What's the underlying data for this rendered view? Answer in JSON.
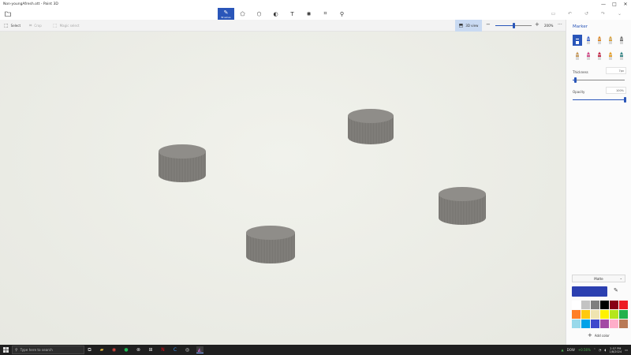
{
  "window": {
    "title": "Non-youngAfresh.ott - Paint 3D",
    "controls": [
      "—",
      "□",
      "✕"
    ]
  },
  "toolbar": {
    "menu_icon": "folder-icon",
    "tools": [
      {
        "name": "brushes",
        "label": "Brushes",
        "icon": "✎",
        "active": true
      },
      {
        "name": "2d-shapes",
        "label": "",
        "icon": "⬠",
        "active": false
      },
      {
        "name": "3d-shapes",
        "label": "",
        "icon": "⬡",
        "active": false
      },
      {
        "name": "stickers",
        "label": "",
        "icon": "◐",
        "active": false
      },
      {
        "name": "text",
        "label": "",
        "icon": "T",
        "active": false
      },
      {
        "name": "effects",
        "label": "",
        "icon": "✺",
        "active": false
      },
      {
        "name": "canvas",
        "label": "",
        "icon": "⌗",
        "active": false
      },
      {
        "name": "3d-library",
        "label": "",
        "icon": "⚲",
        "active": false
      }
    ],
    "right_tools": [
      "▭",
      "↶",
      "↺",
      "↷",
      "⌄"
    ]
  },
  "subbar": {
    "select": "Select",
    "crop": "Crop",
    "magic_select": "Magic select",
    "view_3d": "3D view",
    "zoom_value": "200%",
    "zoom_level": 0.5,
    "more": "···"
  },
  "panel": {
    "title": "Marker",
    "thickness_label": "Thickness",
    "thickness_value": "7px",
    "thickness_level": 0.05,
    "opacity_label": "Opacity",
    "opacity_value": "100%",
    "opacity_level": 1.0,
    "finish": "Matte",
    "current_color": "#2b3fb0",
    "add_color": "Add color",
    "brushes": [
      {
        "name": "marker",
        "color": "#2a56b9",
        "selected": true
      },
      {
        "name": "calligraphy-pen",
        "color": "#4b6fd1",
        "selected": false
      },
      {
        "name": "oil-brush",
        "color": "#e08a2a",
        "selected": false
      },
      {
        "name": "watercolor",
        "color": "#d9a441",
        "selected": false
      },
      {
        "name": "pixel-pen",
        "color": "#777777",
        "selected": false
      },
      {
        "name": "pencil",
        "color": "#c99a5a",
        "selected": false
      },
      {
        "name": "eraser",
        "color": "#d44b8a",
        "selected": false
      },
      {
        "name": "crayon",
        "color": "#c72b4a",
        "selected": false
      },
      {
        "name": "spray-can",
        "color": "#e8a12a",
        "selected": false
      },
      {
        "name": "fill",
        "color": "#3a8a8a",
        "selected": false
      }
    ],
    "palette": [
      "#ffffff",
      "#c3c3c3",
      "#7f7f7f",
      "#000000",
      "#880015",
      "#ed1c24",
      "#ff7f27",
      "#ffc90e",
      "#efe4b0",
      "#fff200",
      "#b5e61d",
      "#22b14c",
      "#99d9ea",
      "#00a2e8",
      "#3f48cc",
      "#a349a4",
      "#ffaec9",
      "#b97a57"
    ]
  },
  "taskbar": {
    "search_placeholder": "Type here to search",
    "apps": [
      "task-view",
      "file-explorer",
      "chrome",
      "spotify",
      "xbox",
      "game-bar",
      "netflix",
      "code",
      "obs",
      "paint-3d"
    ],
    "stock_name": "DOW",
    "stock_change": "+0.56%",
    "time": "2:57 PM",
    "date": "1/8/2024"
  }
}
